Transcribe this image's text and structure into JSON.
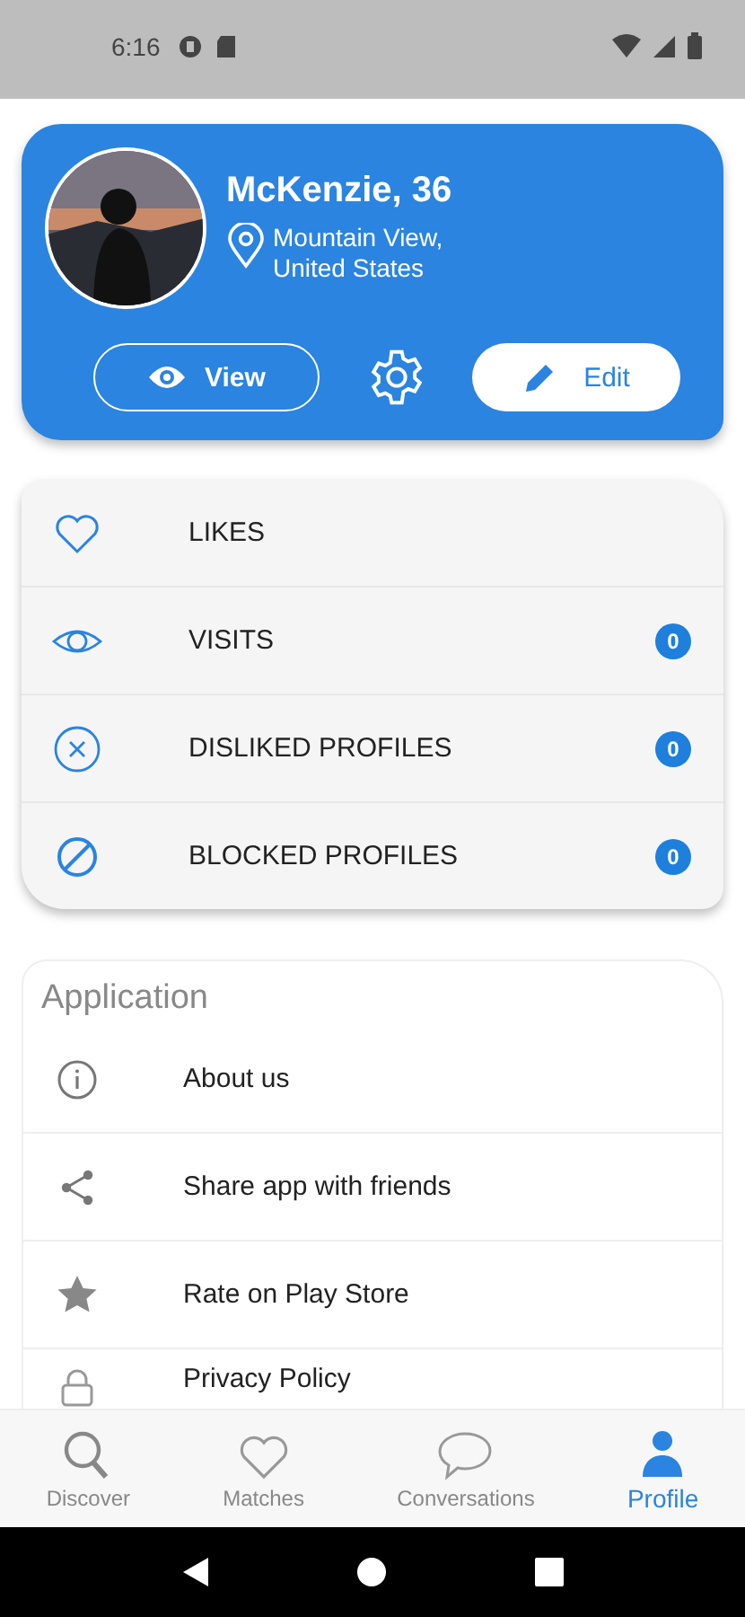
{
  "status_bar": {
    "time": "6:16"
  },
  "profile": {
    "name": "McKenzie, 36",
    "location": "Mountain View,\nUnited States",
    "view_button": "View",
    "edit_button": "Edit"
  },
  "stats": [
    {
      "kind": "heart",
      "label": "LIKES"
    },
    {
      "kind": "eye",
      "label": "VISITS",
      "count": "0"
    },
    {
      "kind": "cross",
      "label": "DISLIKED PROFILES",
      "count": "0"
    },
    {
      "kind": "block",
      "label": "BLOCKED PROFILES",
      "count": "0"
    }
  ],
  "application": {
    "title": "Application",
    "items": [
      {
        "kind": "info",
        "label": "About us"
      },
      {
        "kind": "share",
        "label": "Share app with friends"
      },
      {
        "kind": "star",
        "label": "Rate on Play Store"
      },
      {
        "kind": "lock",
        "label": "Privacy Policy"
      }
    ]
  },
  "bottom_nav": [
    {
      "kind": "search",
      "label": "Discover",
      "selected": false
    },
    {
      "kind": "heart",
      "label": "Matches",
      "selected": false
    },
    {
      "kind": "chat",
      "label": "Conversations",
      "selected": false
    },
    {
      "kind": "person",
      "label": "Profile",
      "selected": true
    }
  ]
}
